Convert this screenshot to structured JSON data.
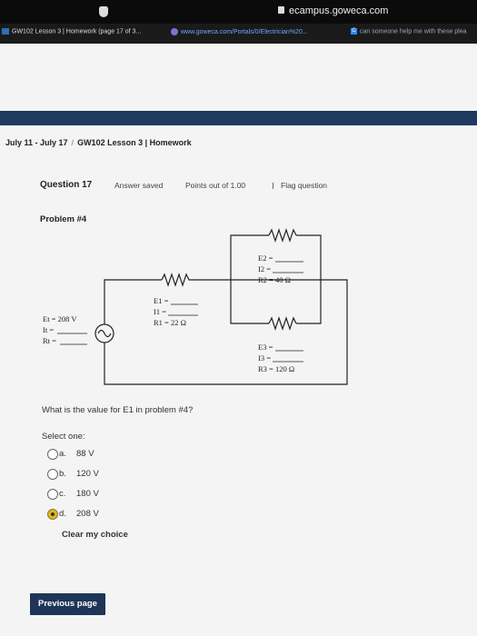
{
  "browser": {
    "url": "ecampus.goweca.com",
    "tabs": [
      {
        "label": "GW102 Lesson 3 | Homework (page 17 of 3..."
      },
      {
        "label": "www.goweca.com/Portals/0/Electrician%20..."
      },
      {
        "label": "can someone help me with these plea"
      }
    ]
  },
  "breadcrumb": {
    "dates": "July 11 - July 17",
    "separator": "/",
    "course": "GW102 Lesson 3 | Homework"
  },
  "question_header": {
    "number": "Question 17",
    "status": "Answer saved",
    "points": "Points out of 1.00",
    "flag": "Flag question"
  },
  "problem": {
    "title": "Problem #4",
    "circuit": {
      "source": {
        "et": "Et = 208 V",
        "it": "It =",
        "rt": "Rt ="
      },
      "r1": {
        "e": "E1 =",
        "i": "I1 =",
        "r": "R1 = 22 Ω"
      },
      "r2": {
        "e": "E2 =",
        "i": "I2 =",
        "r": "R2 = 40 Ω"
      },
      "r3": {
        "e": "E3 =",
        "i": "I3 =",
        "r": "R3 = 120 Ω"
      }
    },
    "question": "What is the value for E1 in problem #4?"
  },
  "answers": {
    "prompt": "Select one:",
    "options": [
      {
        "letter": "a.",
        "value": "88 V",
        "selected": false
      },
      {
        "letter": "b.",
        "value": "120 V",
        "selected": false
      },
      {
        "letter": "c.",
        "value": "180 V",
        "selected": false
      },
      {
        "letter": "d.",
        "value": "208 V",
        "selected": true
      }
    ],
    "clear": "Clear my choice"
  },
  "nav": {
    "previous": "Previous page"
  },
  "colors": {
    "header": "#1f3a5f",
    "selected_radio": "#e8b900",
    "button": "#1e3558"
  }
}
